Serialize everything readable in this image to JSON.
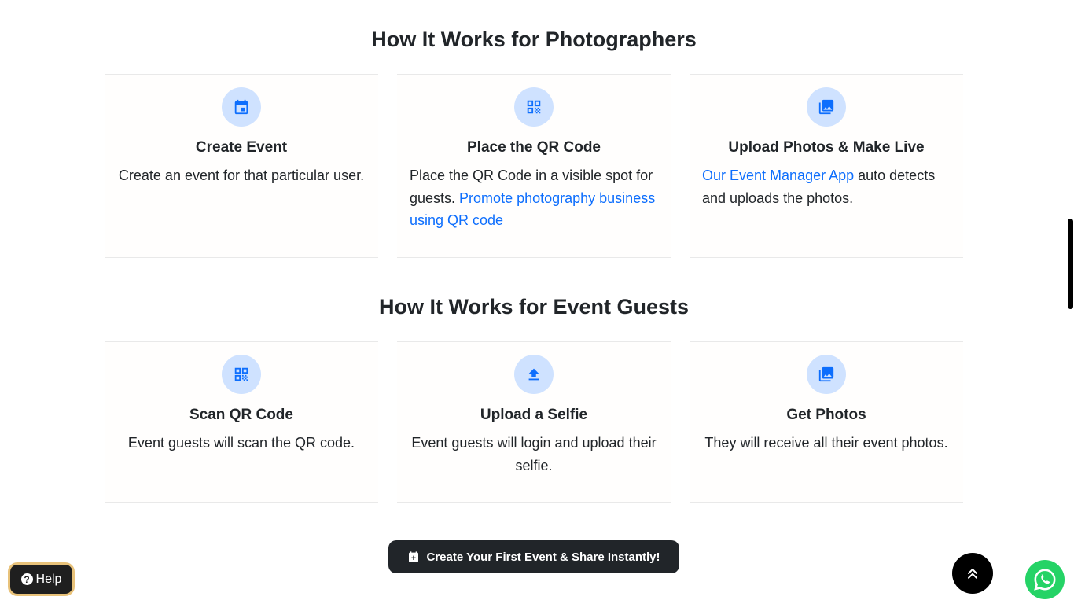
{
  "photographers": {
    "title": "How It Works for Photographers",
    "cards": [
      {
        "icon": "calendar-icon",
        "title": "Create Event",
        "text": "Create an event for that particular user."
      },
      {
        "icon": "qr-code-icon",
        "title": "Place the QR Code",
        "text_before": "Place the QR Code in a visible spot for guests. ",
        "link": "Promote photography business using QR code"
      },
      {
        "icon": "photo-library-icon",
        "title": "Upload Photos & Make Live",
        "link": "Our Event Manager App",
        "text_after": " auto detects and uploads the photos."
      }
    ]
  },
  "guests": {
    "title": "How It Works for Event Guests",
    "cards": [
      {
        "icon": "qr-code-icon",
        "title": "Scan QR Code",
        "text": "Event guests will scan the QR code."
      },
      {
        "icon": "upload-icon",
        "title": "Upload a Selfie",
        "text": "Event guests will login and upload their selfie."
      },
      {
        "icon": "photo-library-icon",
        "title": "Get Photos",
        "text": "They will receive all their event photos."
      }
    ]
  },
  "cta": {
    "icon": "calendar-add-icon",
    "label": "Create Your First Event & Share Instantly!"
  },
  "help": {
    "icon": "question-circle-icon",
    "label": "Help"
  },
  "floating": {
    "scroll_top_icon": "double-chevron-up-icon",
    "whatsapp_icon": "whatsapp-icon"
  },
  "colors": {
    "accent": "#0d6efd",
    "icon_bg": "#cfe2ff",
    "dark": "#212529",
    "whatsapp": "#25d366",
    "help_border": "#e8c27a"
  }
}
